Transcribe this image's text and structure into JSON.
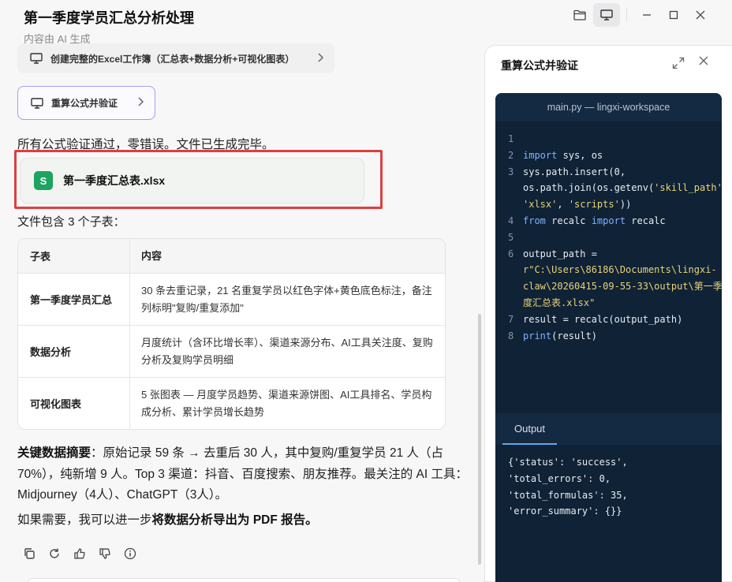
{
  "header": {
    "title": "第一季度学员汇总分析处理",
    "subtitle": "内容由 AI 生成"
  },
  "steps": [
    {
      "label": "创建完整的Excel工作簿（汇总表+数据分析+可视化图表）"
    },
    {
      "label": "重算公式并验证"
    }
  ],
  "message": {
    "verified": "所有公式验证通过，零错误。文件已生成完毕。",
    "file": {
      "icon_letter": "S",
      "name": "第一季度汇总表.xlsx"
    },
    "contains": "文件包含 3 个子表：",
    "table": {
      "headers": [
        "子表",
        "内容"
      ],
      "rows": [
        [
          "第一季度学员汇总",
          "30 条去重记录，21 名重复学员以红色字体+黄色底色标注，备注列标明\"复购/重复添加\""
        ],
        [
          "数据分析",
          "月度统计（含环比增长率）、渠道来源分布、AI工具关注度、复购分析及复购学员明细"
        ],
        [
          "可视化图表",
          "5 张图表 — 月度学员趋势、渠道来源饼图、AI工具排名、学员构成分析、累计学员增长趋势"
        ]
      ]
    },
    "summary_label": "关键数据摘要",
    "summary_text": "：原始记录 59 条 → 去重后 30 人，其中复购/重复学员 21 人（占 70%），纯新增 9 人。Top 3 渠道：抖音、百度搜索、朋友推荐。最关注的 AI 工具：Midjourney（4人）、ChatGPT（3人）。",
    "more_prefix": "如果需要，我可以进一步",
    "more_bold": "将数据分析导出为 PDF 报告。"
  },
  "actions": [
    "copy-icon",
    "regenerate-icon",
    "thumbs-up-icon",
    "thumbs-down-icon",
    "info-icon"
  ],
  "panel": {
    "title": "重算公式并验证",
    "code_header": "main.py — lingxi-workspace",
    "output_tab": "Output",
    "output_lines": [
      "{'status': 'success',",
      "'total_errors': 0,",
      "'total_formulas': 35,",
      "'error_summary': {}}"
    ]
  },
  "colors": {
    "accent_border": "#a39bf5",
    "highlight_box": "#e03d3d",
    "sheet_icon": "#1ea462",
    "code_bg": "#0f2236"
  }
}
